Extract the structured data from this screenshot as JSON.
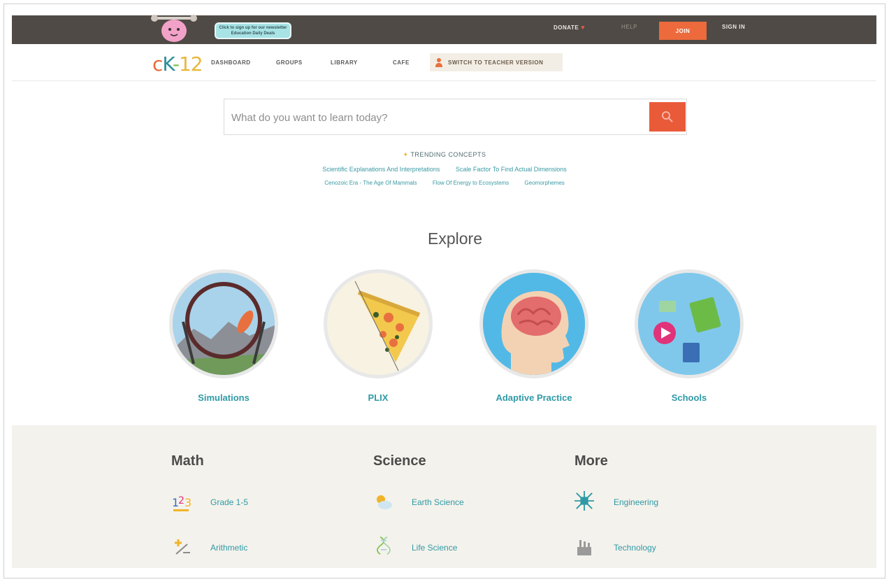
{
  "topbar": {
    "promo_line1": "Click to sign up for our newsletter",
    "promo_line2": "Education Daily Deals",
    "donate": "DONATE",
    "help": "HELP",
    "join": "JOIN",
    "signin": "SIGN IN"
  },
  "nav": {
    "logo_c": "c",
    "logo_k": "K",
    "logo_dash": "-",
    "logo_num": "12",
    "links": [
      "DASHBOARD",
      "GROUPS",
      "LIBRARY",
      "CAFE"
    ],
    "teacher": "SWITCH TO TEACHER VERSION"
  },
  "search": {
    "placeholder": "What do you want to learn today?"
  },
  "trending": {
    "heading": "TRENDING CONCEPTS",
    "row1": [
      "Scientific Explanations And Interpretations",
      "Scale Factor To Find Actual Dimensions"
    ],
    "row2": [
      "Cenozoic Era - The Age Of Mammals",
      "Flow Of Energy to Ecosystems",
      "Geomorphemes"
    ]
  },
  "explore": {
    "title": "Explore",
    "tiles": [
      {
        "label": "Simulations"
      },
      {
        "label": "PLIX"
      },
      {
        "label": "Adaptive Practice"
      },
      {
        "label": "Schools"
      }
    ]
  },
  "subjects": {
    "math": {
      "title": "Math",
      "items": [
        "Grade 1-5",
        "Arithmetic"
      ]
    },
    "science": {
      "title": "Science",
      "items": [
        "Earth Science",
        "Life Science"
      ]
    },
    "more": {
      "title": "More",
      "items": [
        "Engineering",
        "Technology"
      ]
    }
  },
  "colors": {
    "topbar": "#4f4a45",
    "accent": "#ec6a3c",
    "link": "#2f9aa6",
    "footer_bg": "#f4f2ec"
  }
}
